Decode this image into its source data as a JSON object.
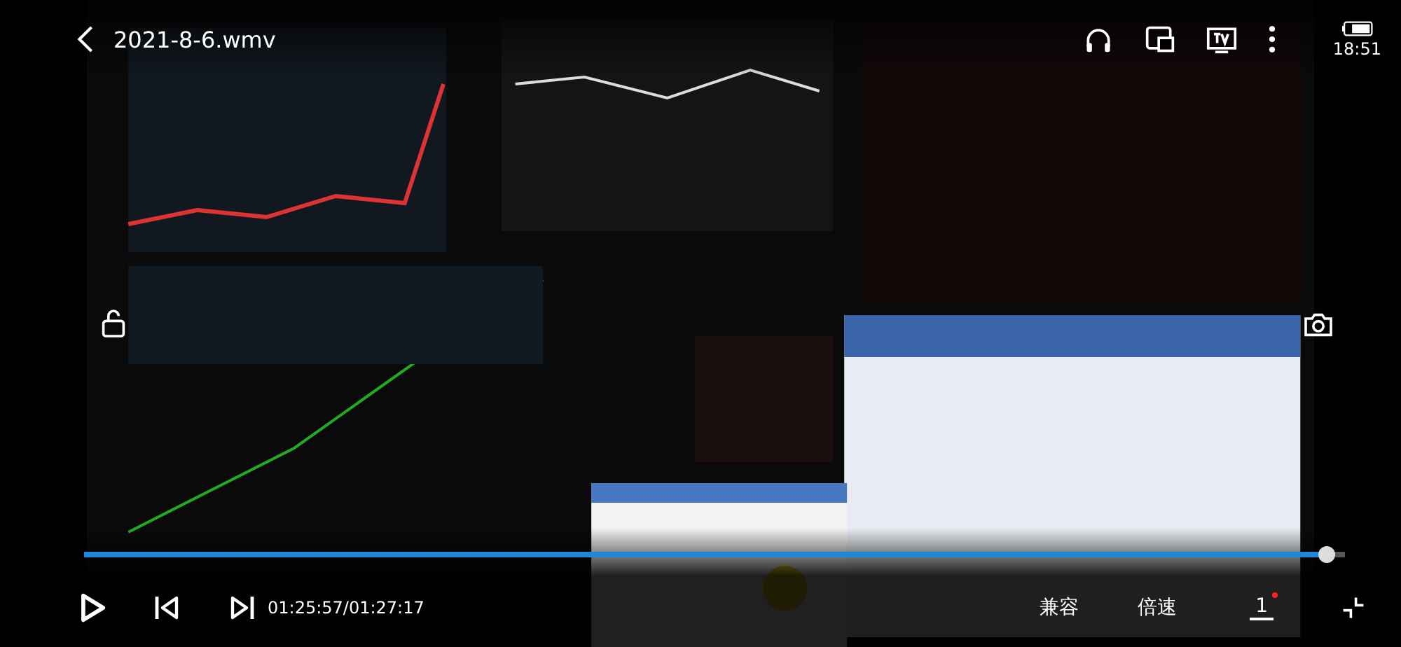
{
  "top_bar": {
    "title": "2021-8-6.wmv",
    "clock": "18:51"
  },
  "playback": {
    "paused": true,
    "level": 0.985,
    "time": "01:25:57/01:27:17"
  },
  "buttons": [
    "兼容",
    "倍速"
  ],
  "episode_badge": "1"
}
